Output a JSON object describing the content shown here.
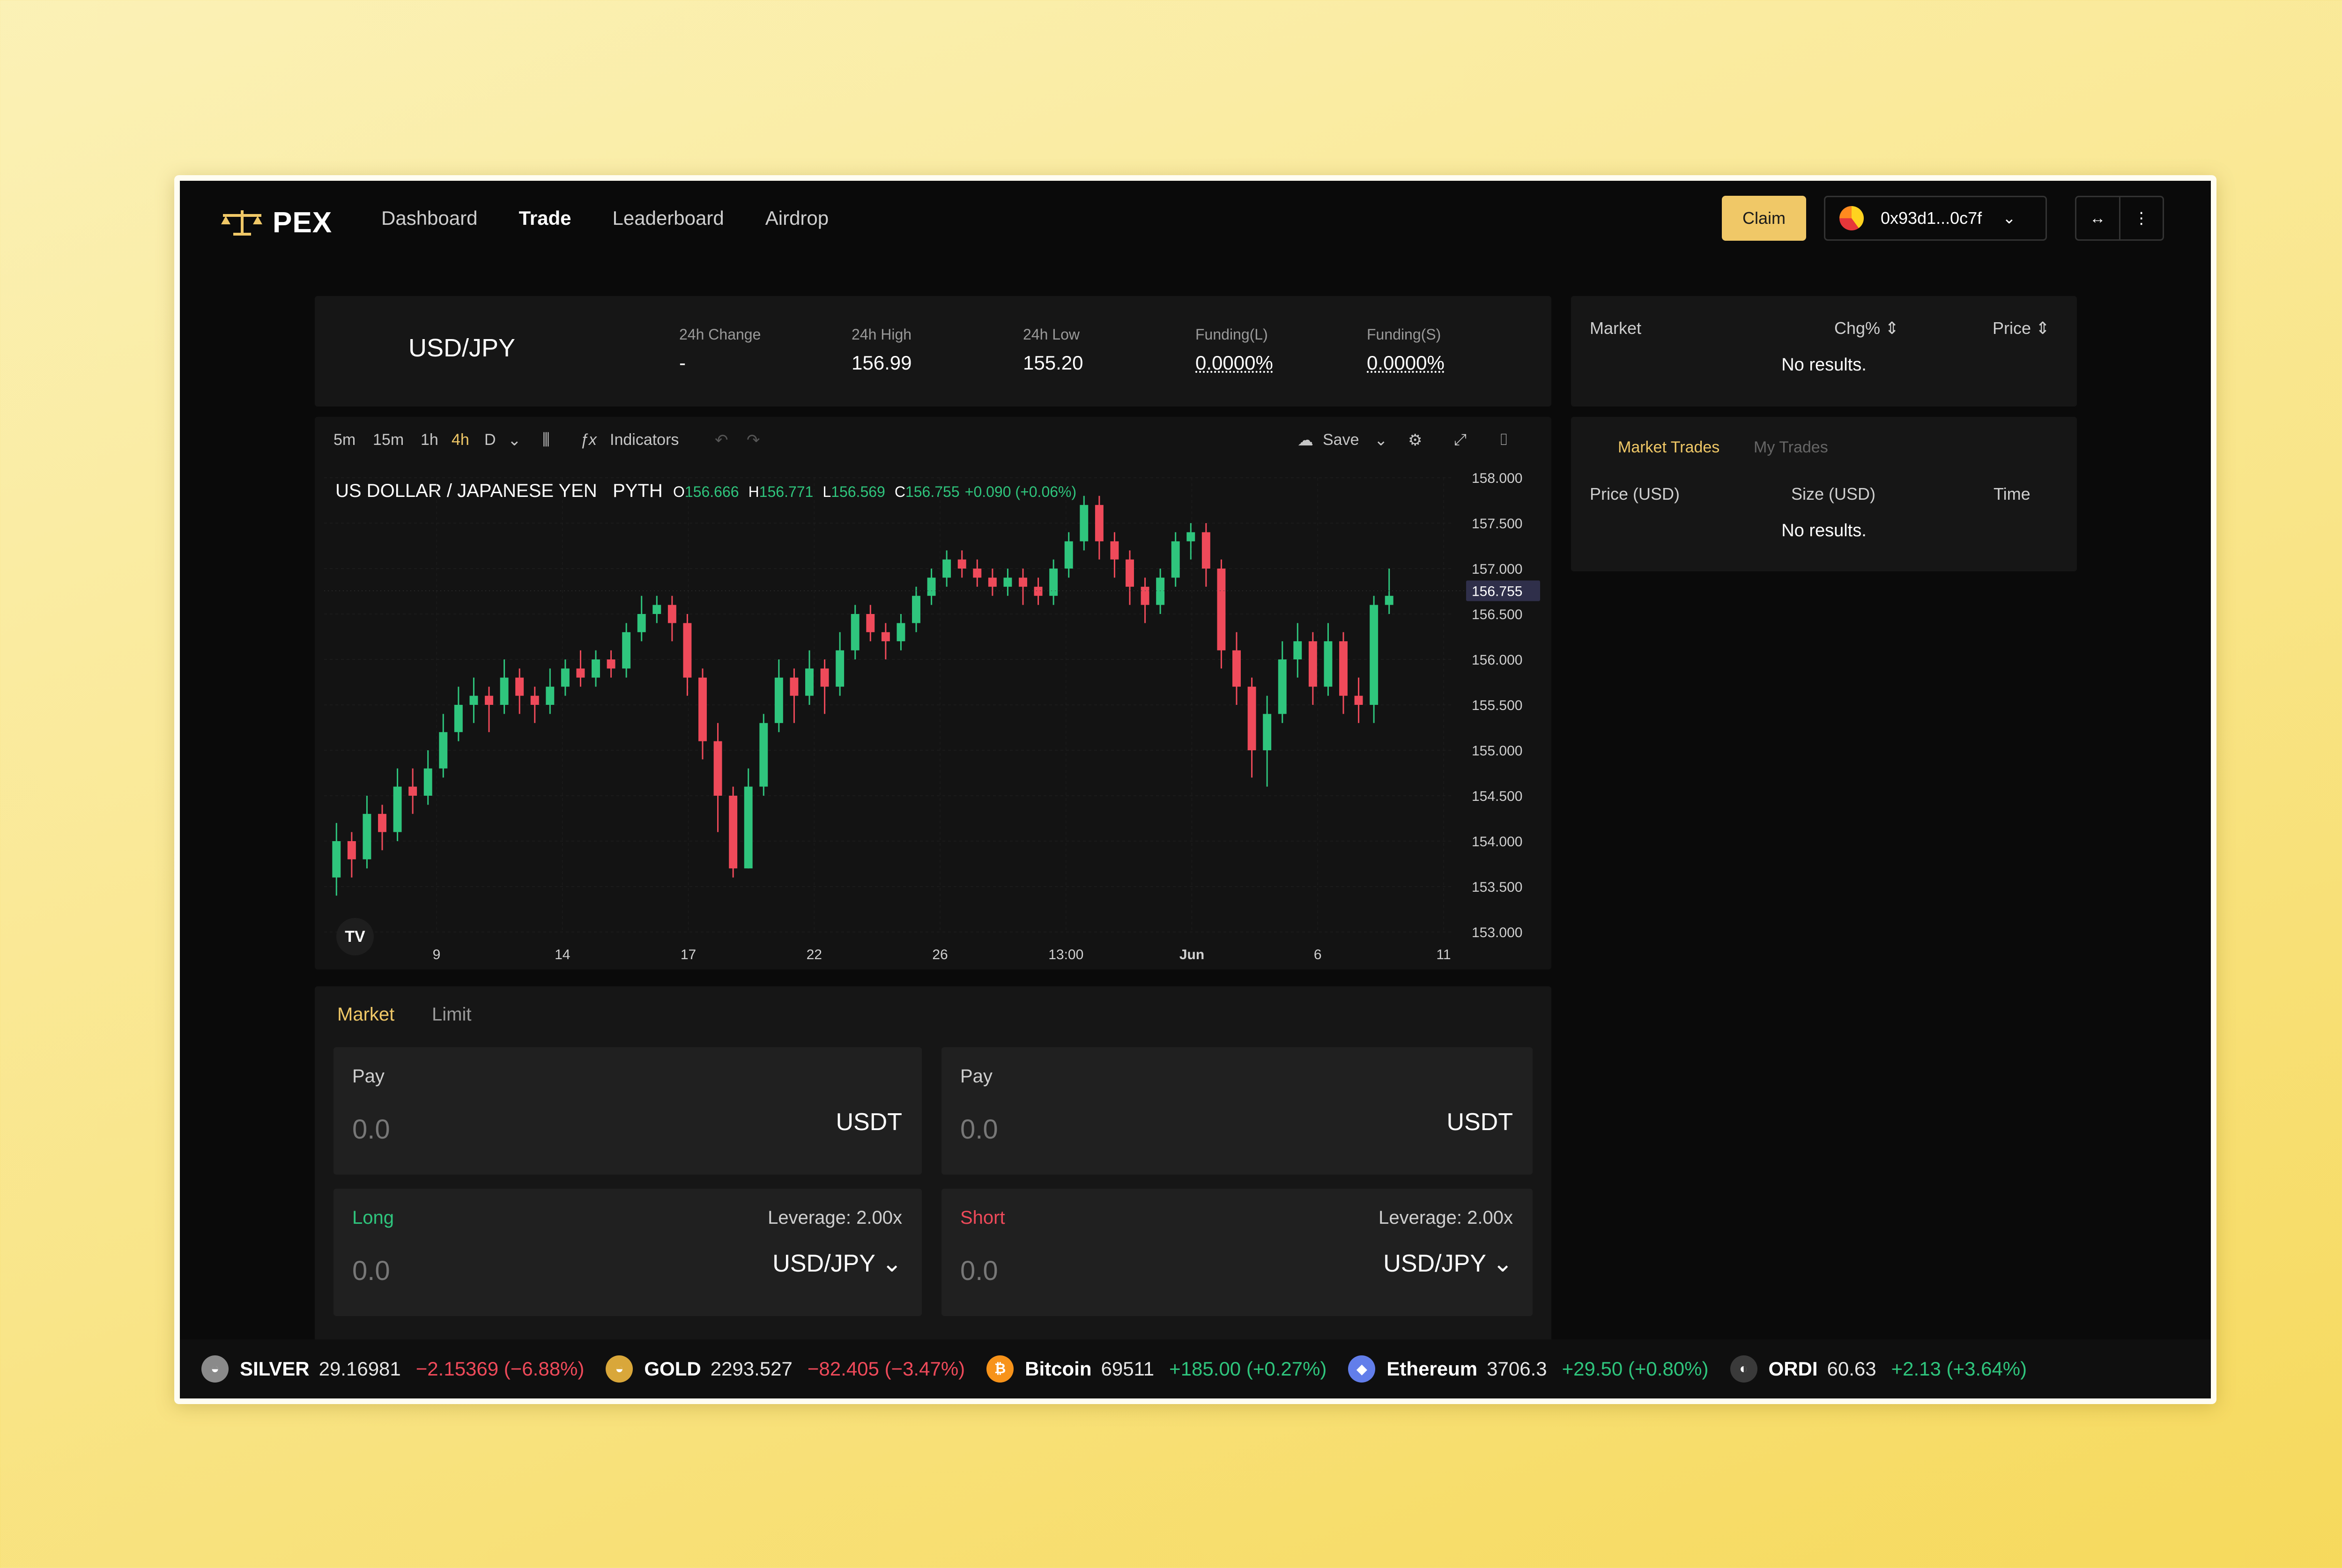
{
  "brand": "PEX",
  "nav": [
    "Dashboard",
    "Trade",
    "Leaderboard",
    "Airdrop"
  ],
  "nav_active": "Trade",
  "claim_label": "Claim",
  "wallet": "0x93d1...0c7f",
  "market": {
    "pair": "USD/JPY",
    "stats": [
      {
        "label": "24h Change",
        "value": "-"
      },
      {
        "label": "24h High",
        "value": "156.99"
      },
      {
        "label": "24h Low",
        "value": "155.20"
      },
      {
        "label": "Funding(L)",
        "value": "0.0000%"
      },
      {
        "label": "Funding(S)",
        "value": "0.0000%"
      }
    ]
  },
  "toolbar": {
    "timeframes": [
      "5m",
      "15m",
      "1h",
      "4h",
      "D"
    ],
    "active_timeframe": "4h",
    "indicators_label": "Indicators",
    "save_label": "Save"
  },
  "legend": {
    "symbol": "US DOLLAR / JAPANESE YEN",
    "source": "PYTH",
    "open": "156.666",
    "high": "156.771",
    "low": "156.569",
    "close": "156.755",
    "change": "+0.090 (+0.06%)"
  },
  "chart_data": {
    "type": "candlestick",
    "price_axis": [
      "158.000",
      "157.500",
      "157.000",
      "156.500",
      "156.000",
      "155.500",
      "155.000",
      "154.500",
      "154.000",
      "153.500",
      "153.000"
    ],
    "ylim": [
      153.0,
      158.0
    ],
    "time_axis": [
      "9",
      "14",
      "17",
      "22",
      "26",
      "13:00",
      "Jun",
      "6",
      "11"
    ],
    "last_price": "156.755",
    "candles": [
      [
        153.6,
        154.0,
        154.2,
        153.4
      ],
      [
        154.0,
        153.8,
        154.1,
        153.6
      ],
      [
        153.8,
        154.3,
        154.5,
        153.7
      ],
      [
        154.3,
        154.1,
        154.4,
        153.9
      ],
      [
        154.1,
        154.6,
        154.8,
        154.0
      ],
      [
        154.6,
        154.5,
        154.8,
        154.3
      ],
      [
        154.5,
        154.8,
        155.0,
        154.4
      ],
      [
        154.8,
        155.2,
        155.4,
        154.7
      ],
      [
        155.2,
        155.5,
        155.7,
        155.1
      ],
      [
        155.5,
        155.6,
        155.8,
        155.3
      ],
      [
        155.6,
        155.5,
        155.7,
        155.2
      ],
      [
        155.5,
        155.8,
        156.0,
        155.4
      ],
      [
        155.8,
        155.6,
        155.9,
        155.4
      ],
      [
        155.6,
        155.5,
        155.7,
        155.3
      ],
      [
        155.5,
        155.7,
        155.9,
        155.4
      ],
      [
        155.7,
        155.9,
        156.0,
        155.6
      ],
      [
        155.9,
        155.8,
        156.1,
        155.7
      ],
      [
        155.8,
        156.0,
        156.1,
        155.7
      ],
      [
        156.0,
        155.9,
        156.1,
        155.8
      ],
      [
        155.9,
        156.3,
        156.4,
        155.8
      ],
      [
        156.3,
        156.5,
        156.7,
        156.2
      ],
      [
        156.5,
        156.6,
        156.7,
        156.4
      ],
      [
        156.6,
        156.4,
        156.7,
        156.2
      ],
      [
        156.4,
        155.8,
        156.5,
        155.6
      ],
      [
        155.8,
        155.1,
        155.9,
        154.9
      ],
      [
        155.1,
        154.5,
        155.3,
        154.1
      ],
      [
        154.5,
        153.7,
        154.6,
        153.6
      ],
      [
        153.7,
        154.6,
        154.8,
        153.7
      ],
      [
        154.6,
        155.3,
        155.4,
        154.5
      ],
      [
        155.3,
        155.8,
        156.0,
        155.2
      ],
      [
        155.8,
        155.6,
        155.9,
        155.3
      ],
      [
        155.6,
        155.9,
        156.1,
        155.5
      ],
      [
        155.9,
        155.7,
        156.0,
        155.4
      ],
      [
        155.7,
        156.1,
        156.3,
        155.6
      ],
      [
        156.1,
        156.5,
        156.6,
        156.0
      ],
      [
        156.5,
        156.3,
        156.6,
        156.2
      ],
      [
        156.3,
        156.2,
        156.4,
        156.0
      ],
      [
        156.2,
        156.4,
        156.5,
        156.1
      ],
      [
        156.4,
        156.7,
        156.8,
        156.3
      ],
      [
        156.7,
        156.9,
        157.0,
        156.6
      ],
      [
        156.9,
        157.1,
        157.2,
        156.8
      ],
      [
        157.1,
        157.0,
        157.2,
        156.9
      ],
      [
        157.0,
        156.9,
        157.1,
        156.8
      ],
      [
        156.9,
        156.8,
        157.0,
        156.7
      ],
      [
        156.8,
        156.9,
        157.0,
        156.7
      ],
      [
        156.9,
        156.8,
        157.0,
        156.6
      ],
      [
        156.8,
        156.7,
        156.9,
        156.6
      ],
      [
        156.7,
        157.0,
        157.1,
        156.6
      ],
      [
        157.0,
        157.3,
        157.4,
        156.9
      ],
      [
        157.3,
        157.7,
        157.8,
        157.2
      ],
      [
        157.7,
        157.3,
        157.8,
        157.1
      ],
      [
        157.3,
        157.1,
        157.4,
        156.9
      ],
      [
        157.1,
        156.8,
        157.2,
        156.6
      ],
      [
        156.8,
        156.6,
        156.9,
        156.4
      ],
      [
        156.6,
        156.9,
        157.0,
        156.5
      ],
      [
        156.9,
        157.3,
        157.4,
        156.8
      ],
      [
        157.3,
        157.4,
        157.5,
        157.1
      ],
      [
        157.4,
        157.0,
        157.5,
        156.8
      ],
      [
        157.0,
        156.1,
        157.1,
        155.9
      ],
      [
        156.1,
        155.7,
        156.3,
        155.5
      ],
      [
        155.7,
        155.0,
        155.8,
        154.7
      ],
      [
        155.0,
        155.4,
        155.6,
        154.6
      ],
      [
        155.4,
        156.0,
        156.2,
        155.3
      ],
      [
        156.0,
        156.2,
        156.4,
        155.8
      ],
      [
        156.2,
        155.7,
        156.3,
        155.5
      ],
      [
        155.7,
        156.2,
        156.4,
        155.6
      ],
      [
        156.2,
        155.6,
        156.3,
        155.4
      ],
      [
        155.6,
        155.5,
        155.8,
        155.3
      ],
      [
        155.5,
        156.6,
        156.7,
        155.3
      ],
      [
        156.6,
        156.7,
        157.0,
        156.5
      ]
    ]
  },
  "order": {
    "tabs": [
      "Market",
      "Limit"
    ],
    "active_tab": "Market",
    "pay_label": "Pay",
    "pay_value": "0.0",
    "pay_unit": "USDT",
    "long_label": "Long",
    "short_label": "Short",
    "leverage": "Leverage: 2.00x",
    "position_value": "0.0",
    "position_unit": "USD/JPY"
  },
  "markets_panel": {
    "col_market": "Market",
    "col_chg": "Chg%",
    "col_price": "Price",
    "empty": "No results."
  },
  "trades_panel": {
    "tabs": [
      "Market Trades",
      "My Trades"
    ],
    "col_price": "Price (USD)",
    "col_size": "Size (USD)",
    "col_time": "Time",
    "empty": "No results."
  },
  "ticker": [
    {
      "name": "SILVER",
      "price": "29.16981",
      "change": "−2.15369 (−6.88%)",
      "dir": "down",
      "icon": "silver-coin-icon",
      "color": "#8a8a8a"
    },
    {
      "name": "GOLD",
      "price": "2293.527",
      "change": "−82.405 (−3.47%)",
      "dir": "down",
      "icon": "gold-coin-icon",
      "color": "#d9a73a"
    },
    {
      "name": "Bitcoin",
      "price": "69511",
      "change": "+185.00 (+0.27%)",
      "dir": "up",
      "icon": "bitcoin-icon",
      "color": "#f7931a"
    },
    {
      "name": "Ethereum",
      "price": "3706.3",
      "change": "+29.50 (+0.80%)",
      "dir": "up",
      "icon": "ethereum-icon",
      "color": "#627eea"
    },
    {
      "name": "ORDI",
      "price": "60.63",
      "change": "+2.13 (+3.64%)",
      "dir": "up",
      "icon": "ordi-icon",
      "color": "#3a3a3a"
    }
  ],
  "colors": {
    "accent": "#f0c867",
    "up": "#2fc57d",
    "down": "#ef4a5a",
    "bg": "#0a0a0a",
    "panel": "#161616"
  }
}
